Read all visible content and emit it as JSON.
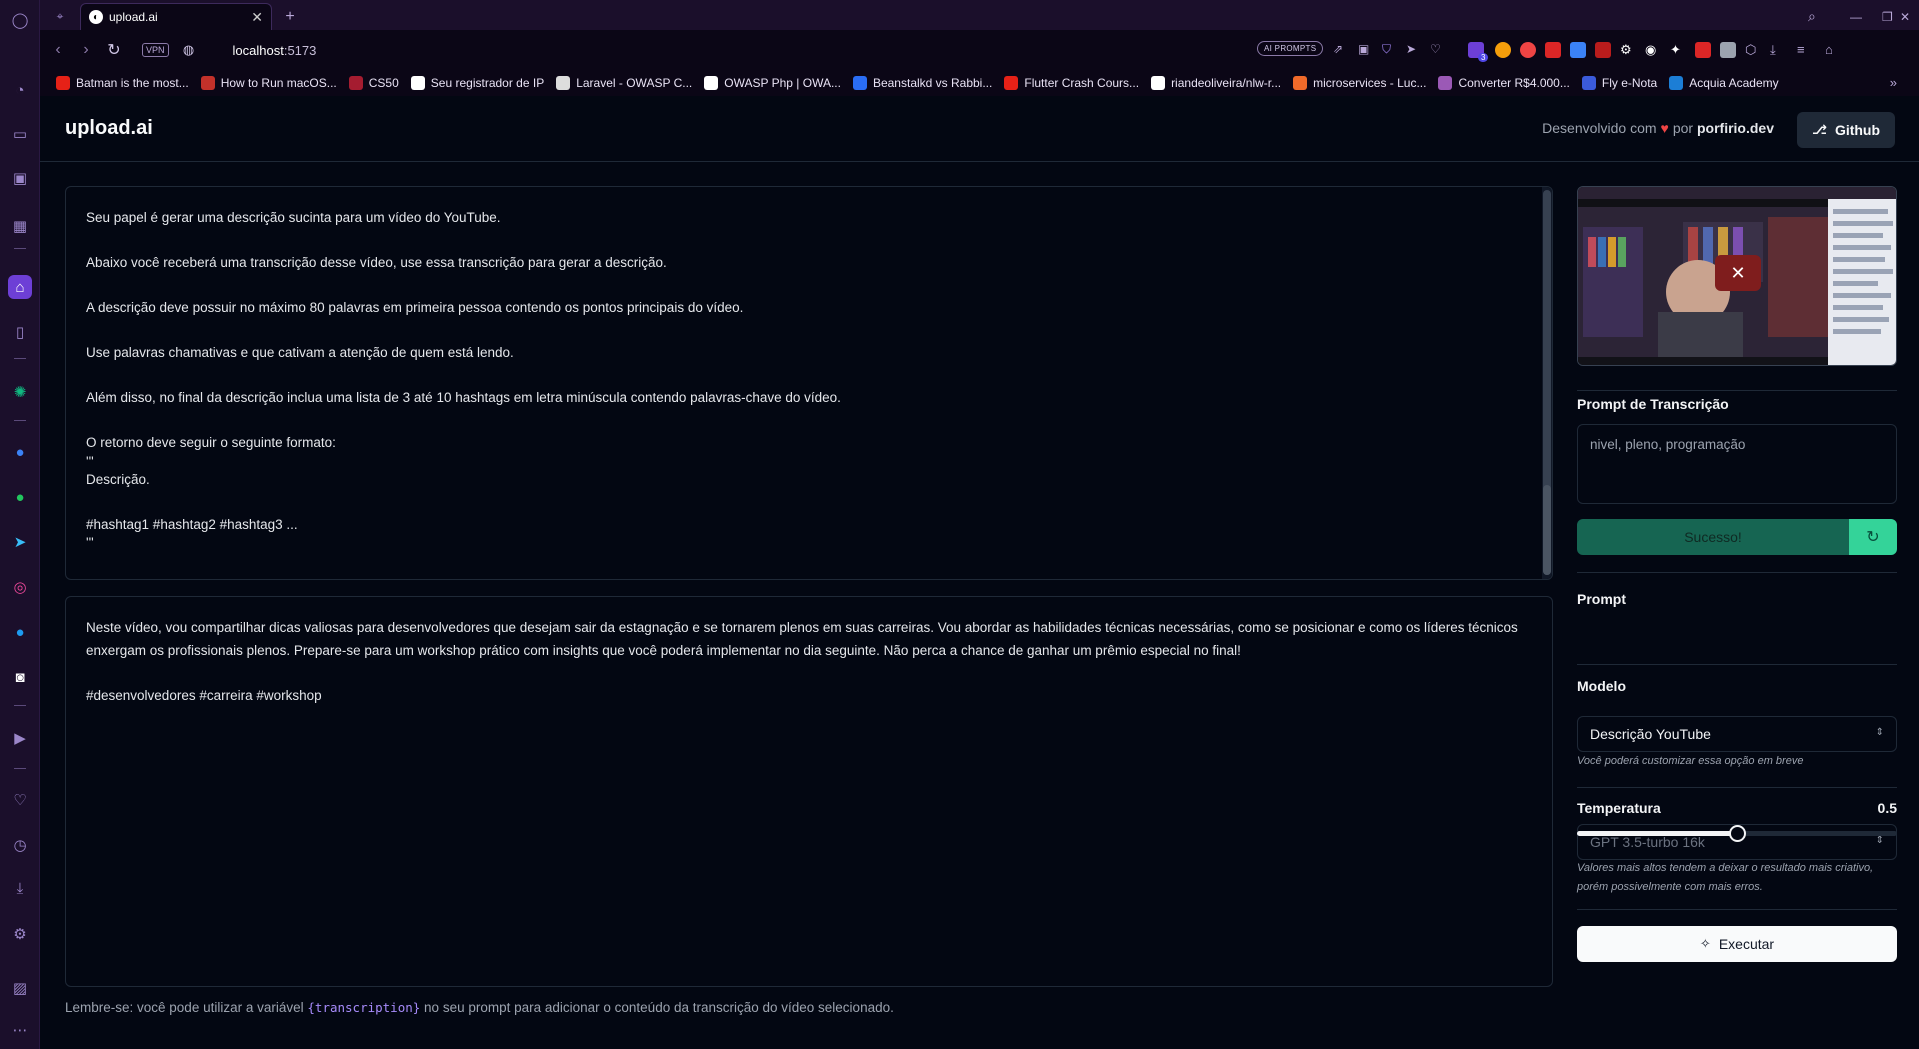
{
  "browser": {
    "tab_title": "upload.ai",
    "url_host": "localhost",
    "url_port": ":5173",
    "vpn_label": "VPN",
    "ai_prompts_label": "AI PROMPTS",
    "extensions_badge": "3",
    "bookmarks": [
      {
        "label": "Batman is the most...",
        "color": "#e62117"
      },
      {
        "label": "How to Run macOS...",
        "color": "#c3312a"
      },
      {
        "label": "CS50",
        "color": "#a51c30"
      },
      {
        "label": "Seu registrador de IP",
        "color": "#ffffff"
      },
      {
        "label": "Laravel - OWASP C...",
        "color": "#dddddd"
      },
      {
        "label": "OWASP Php | OWA...",
        "color": "#ffffff"
      },
      {
        "label": "Beanstalkd vs Rabbi...",
        "color": "#2a6df4"
      },
      {
        "label": "Flutter Crash Cours...",
        "color": "#e62117"
      },
      {
        "label": "riandeoliveira/nlw-r...",
        "color": "#ffffff"
      },
      {
        "label": "microservices - Luc...",
        "color": "#f06a2a"
      },
      {
        "label": "Converter R$4.000...",
        "color": "#9b59b6"
      },
      {
        "label": "Fly e-Nota",
        "color": "#3b5bdb"
      },
      {
        "label": "Acquia Academy",
        "color": "#1c7ed6"
      }
    ]
  },
  "header": {
    "logo": "upload.ai",
    "credit_prefix": "Desenvolvido com",
    "credit_by": "por",
    "credit_author": "porfirio.dev",
    "github_label": "Github"
  },
  "prompt_panel": {
    "lines": [
      "Seu papel é gerar uma descrição sucinta para um vídeo do YouTube.",
      "",
      "Abaixo você receberá uma transcrição desse vídeo, use essa transcrição para gerar a descrição.",
      "",
      "A descrição deve possuir no máximo 80 palavras em primeira pessoa contendo os pontos principais do vídeo.",
      "",
      "Use palavras chamativas e que cativam a atenção de quem está lendo.",
      "",
      "Além disso, no final da descrição inclua uma lista de 3 até 10 hashtags em letra minúscula contendo palavras-chave do vídeo.",
      "",
      "O retorno deve seguir o seguinte formato:",
      "'''",
      "Descrição.",
      "",
      "#hashtag1 #hashtag2 #hashtag3 ...",
      "'''"
    ]
  },
  "result_panel": {
    "paragraph": "Neste vídeo, vou compartilhar dicas valiosas para desenvolvedores que desejam sair da estagnação e se tornarem plenos em suas carreiras. Vou abordar as habilidades técnicas necessárias, como se posicionar e como os líderes técnicos enxergam os profissionais plenos. Prepare-se para um workshop prático com insights que você poderá implementar no dia seguinte. Não perca a chance de ganhar um prêmio especial no final!",
    "hashtags": "#desenvolvedores #carreira #workshop"
  },
  "footer": {
    "prefix": "Lembre-se: você pode utilizar a variável",
    "variable": "{transcription}",
    "suffix": "no seu prompt para adicionar o conteúdo da transcrição do vídeo selecionado."
  },
  "sidebar": {
    "transcription_label": "Prompt de Transcrição",
    "transcription_placeholder": "nivel, pleno, programação",
    "success_label": "Sucesso!",
    "prompt_label": "Prompt",
    "prompt_value": "Descrição YouTube",
    "model_label": "Modelo",
    "model_value": "GPT 3.5-turbo 16k",
    "model_hint": "Você poderá customizar essa opção em breve",
    "temperature_label": "Temperatura",
    "temperature_value": "0.5",
    "temperature_fraction": 0.5,
    "temperature_hint": "Valores mais altos tendem a deixar o resultado mais criativo, porém possivelmente com mais erros.",
    "run_label": "Executar"
  },
  "icons": {
    "video_remove": "close-icon",
    "retry": "refresh-icon",
    "run": "magic-wand-icon",
    "github": "github-icon"
  }
}
